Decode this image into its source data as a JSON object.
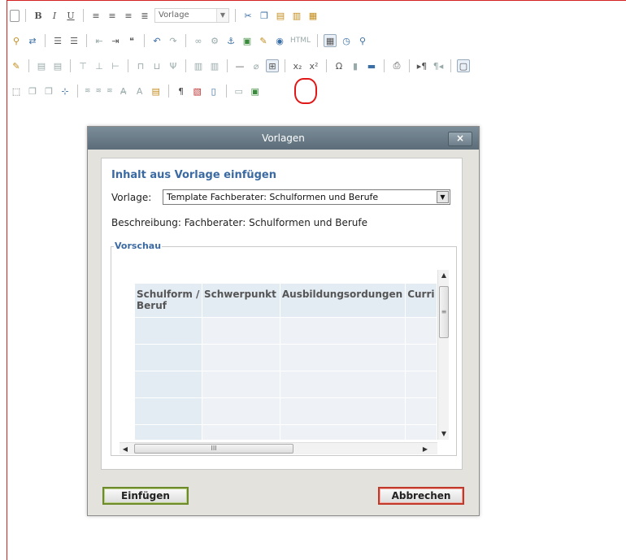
{
  "toolbar": {
    "style_combo": "Vorlage",
    "html_icon_label": "HTML",
    "table_indicator": "⊞"
  },
  "colors": {
    "accent_title": "#3b6aa3",
    "annotation_red": "#e01818",
    "confirm_border": "#6d8b2a",
    "cancel_border": "#c0392b"
  },
  "dialog": {
    "title": "Vorlagen",
    "close": "×",
    "heading": "Inhalt aus Vorlage einfügen",
    "vorlage_label": "Vorlage:",
    "vorlage_value": "Template Fachberater: Schulformen und Berufe",
    "description": "Beschreibung: Fachberater: Schulformen und Berufe",
    "preview_legend": "Vorschau",
    "columns": [
      "Schulform / Beruf",
      "Schwerpunkt",
      "Ausbildungsordungen",
      "Curri"
    ],
    "rows": 5,
    "hscroll_grip": "III",
    "vscroll_grip": "≡",
    "insert_button": "Einfügen",
    "cancel_button": "Abbrechen"
  }
}
